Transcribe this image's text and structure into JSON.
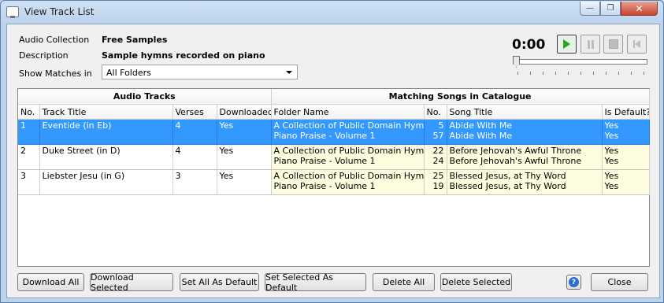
{
  "window": {
    "title": "View Track List"
  },
  "info": {
    "collection_label": "Audio Collection",
    "collection_value": "Free Samples",
    "description_label": "Description",
    "description_value": "Sample hymns recorded on piano",
    "show_matches_label": "Show Matches in",
    "show_matches_selected": "All Folders"
  },
  "player": {
    "time": "0:00",
    "position": 0
  },
  "table": {
    "group_headers": [
      "Audio Tracks",
      "Matching Songs in Catalogue"
    ],
    "columns": [
      "No.",
      "Track Title",
      "Verses",
      "Downloaded?",
      "Folder Name",
      "No.",
      "Song Title",
      "Is Default?"
    ],
    "rows": [
      {
        "no": "1",
        "title": "Eventide (in Eb)",
        "verses": "4",
        "downloaded": "Yes",
        "folders": [
          "A Collection of Public Domain Hymns",
          "Piano Praise - Volume 1"
        ],
        "song_nos": [
          "5",
          "57"
        ],
        "songs": [
          "Abide With Me",
          "Abide With Me"
        ],
        "defaults": [
          "Yes",
          "Yes"
        ]
      },
      {
        "no": "2",
        "title": "Duke Street (in D)",
        "verses": "4",
        "downloaded": "Yes",
        "folders": [
          "A Collection of Public Domain Hymns",
          "Piano Praise - Volume 1"
        ],
        "song_nos": [
          "22",
          "24"
        ],
        "songs": [
          "Before Jehovah's Awful Throne",
          "Before Jehovah's Awful Throne"
        ],
        "defaults": [
          "Yes",
          "Yes"
        ]
      },
      {
        "no": "3",
        "title": "Liebster Jesu (in G)",
        "verses": "3",
        "downloaded": "Yes",
        "folders": [
          "A Collection of Public Domain Hymns",
          "Piano Praise - Volume 1"
        ],
        "song_nos": [
          "25",
          "19"
        ],
        "songs": [
          "Blessed Jesus, at Thy Word",
          "Blessed Jesus, at Thy Word"
        ],
        "defaults": [
          "Yes",
          "Yes"
        ]
      }
    ]
  },
  "buttons": {
    "download_all": "Download All",
    "download_selected": "Download Selected",
    "set_all_default": "Set All As Default",
    "set_selected_default": "Set Selected As Default",
    "delete_all": "Delete All",
    "delete_selected": "Delete Selected",
    "close": "Close"
  }
}
